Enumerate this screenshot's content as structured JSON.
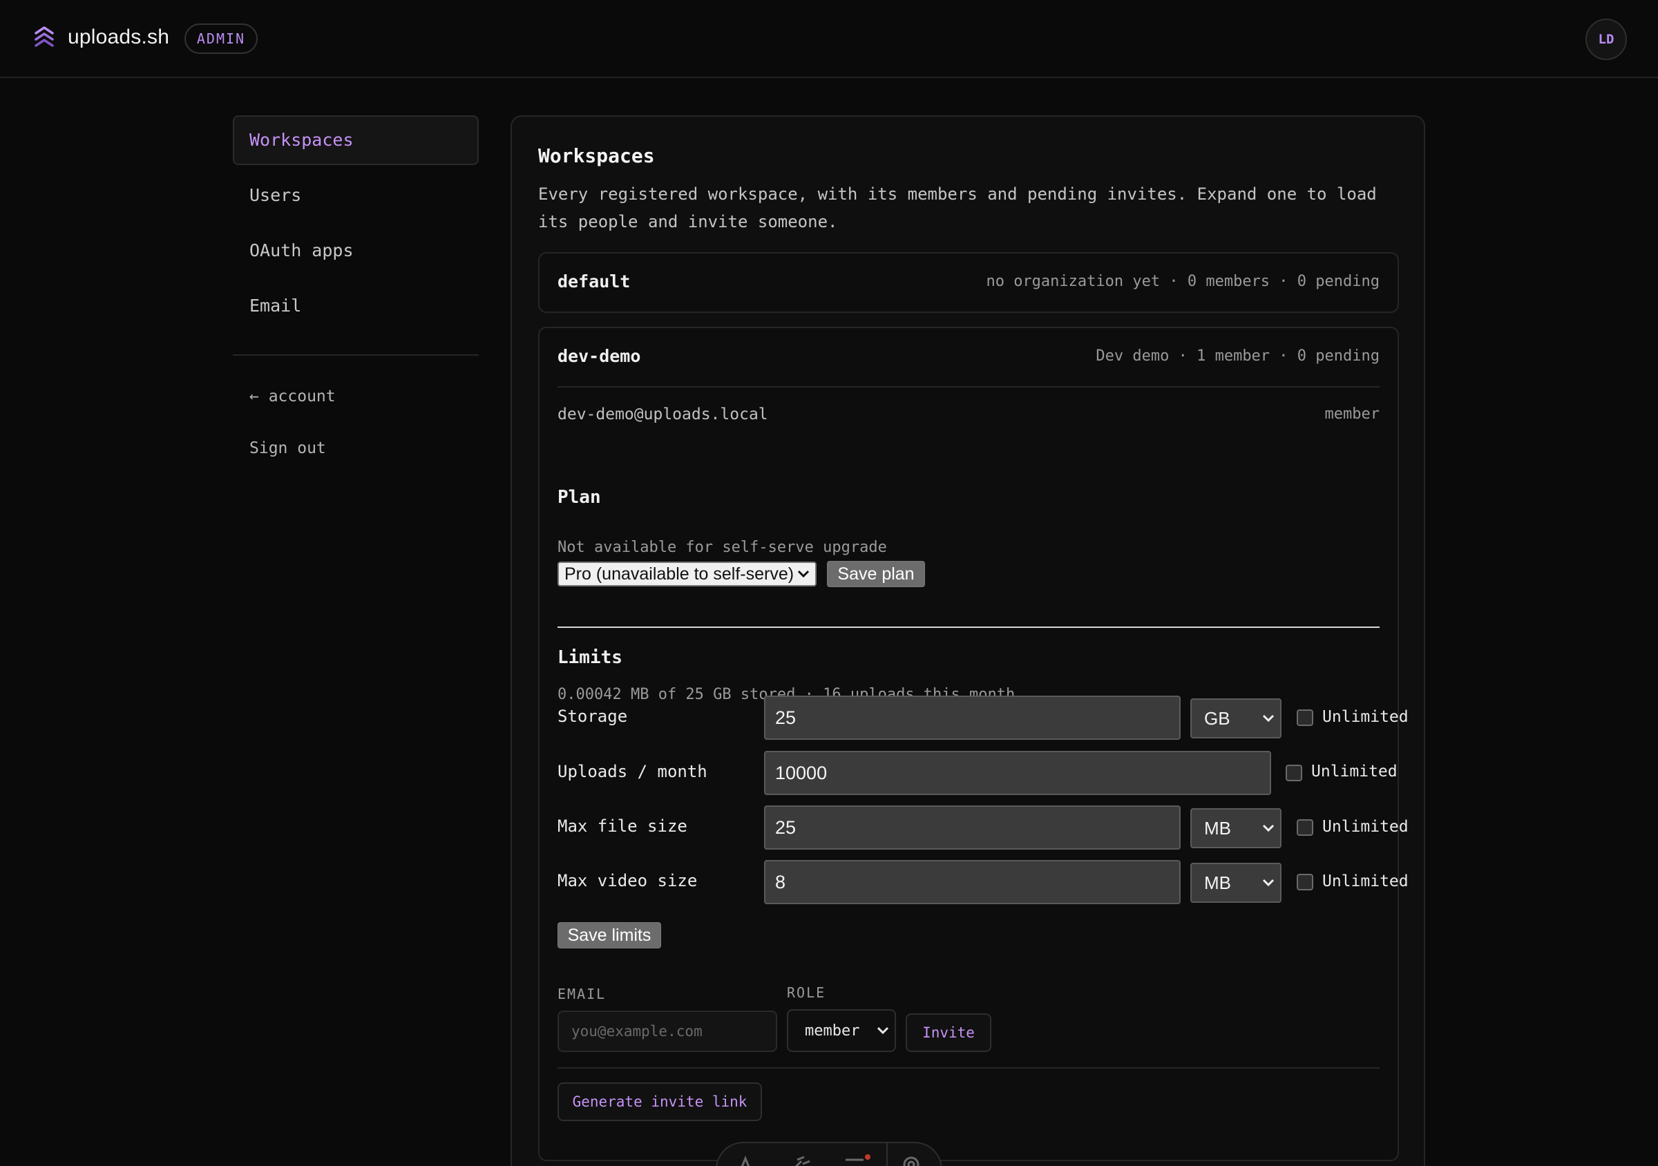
{
  "app": {
    "brand": "uploads.sh",
    "badge": "ADMIN",
    "avatar_initials": "LD"
  },
  "sidebar": {
    "items": [
      {
        "label": "Workspaces",
        "active": true
      },
      {
        "label": "Users"
      },
      {
        "label": "OAuth apps"
      },
      {
        "label": "Email"
      }
    ],
    "back_link": "← account",
    "sign_out": "Sign out"
  },
  "main": {
    "title": "Workspaces",
    "description": "Every registered workspace, with its members and pending invites. Expand one to load its people and invite someone."
  },
  "workspaces": [
    {
      "name": "default",
      "meta": "no organization yet · 0 members · 0 pending"
    },
    {
      "name": "dev-demo",
      "meta": "Dev demo · 1 member · 0 pending",
      "members": [
        {
          "email": "dev-demo@uploads.local",
          "role": "member"
        }
      ],
      "plan": {
        "heading": "Plan",
        "note": "Not available for self-serve upgrade",
        "selected": "Pro (unavailable to self-serve)",
        "save_label": "Save plan"
      },
      "limits": {
        "heading": "Limits",
        "usage": "0.00042 MB of 25 GB stored · 16 uploads this month",
        "rows": [
          {
            "label": "Storage",
            "value": "25",
            "unit": "GB",
            "unlimited": "Unlimited"
          },
          {
            "label": "Uploads / month",
            "value": "10000",
            "unlimited": "Unlimited"
          },
          {
            "label": "Max file size",
            "value": "25",
            "unit": "MB",
            "unlimited": "Unlimited"
          },
          {
            "label": "Max video size",
            "value": "8",
            "unit": "MB",
            "unlimited": "Unlimited"
          }
        ],
        "save_label": "Save limits"
      },
      "invite": {
        "email_caption": "EMAIL",
        "email_placeholder": "you@example.com",
        "role_caption": "ROLE",
        "role_selected": "member",
        "invite_label": "Invite",
        "generate_label": "Generate invite link"
      }
    }
  ],
  "colors": {
    "accent": "#c592f6",
    "background": "#0a0a0a",
    "panel": "#0f0f0f"
  },
  "icons": [
    "logo-icon",
    "chevron-down-icon",
    "text-tool-icon",
    "brush-icon",
    "menu-icon",
    "settings-icon"
  ]
}
